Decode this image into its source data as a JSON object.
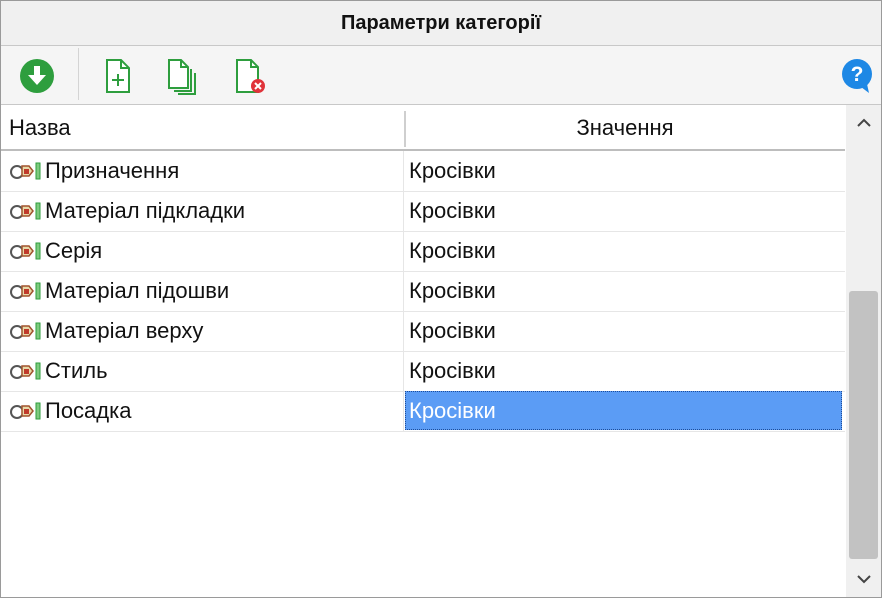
{
  "window": {
    "title": "Параметри категорії"
  },
  "toolbar": {
    "buttons": [
      {
        "icon": "download-circle-icon",
        "color": "#2e9e3e"
      },
      {
        "icon": "add-document-icon",
        "color": "#2e9e3e"
      },
      {
        "icon": "copy-documents-icon",
        "color": "#2e9e3e"
      },
      {
        "icon": "delete-document-icon",
        "color": "#e0333a"
      },
      {
        "icon": "help-icon",
        "color": "#1e88e5"
      }
    ]
  },
  "table": {
    "columns": [
      "Назва",
      "Значення"
    ],
    "rows": [
      {
        "name": "Призначення",
        "value": "Кросівки"
      },
      {
        "name": "Матеріал підкладки",
        "value": "Кросівки"
      },
      {
        "name": "Серія",
        "value": "Кросівки"
      },
      {
        "name": "Матеріал підошви",
        "value": "Кросівки"
      },
      {
        "name": "Матеріал верху",
        "value": "Кросівки"
      },
      {
        "name": "Стиль",
        "value": "Кросівки"
      },
      {
        "name": "Посадка",
        "value": "Кросівки",
        "selected": true
      }
    ],
    "row_icon": "parameter-icon"
  },
  "colors": {
    "selection": "#5b9cf5",
    "green_accent": "#2e9e3e",
    "help_blue": "#1e88e5"
  }
}
